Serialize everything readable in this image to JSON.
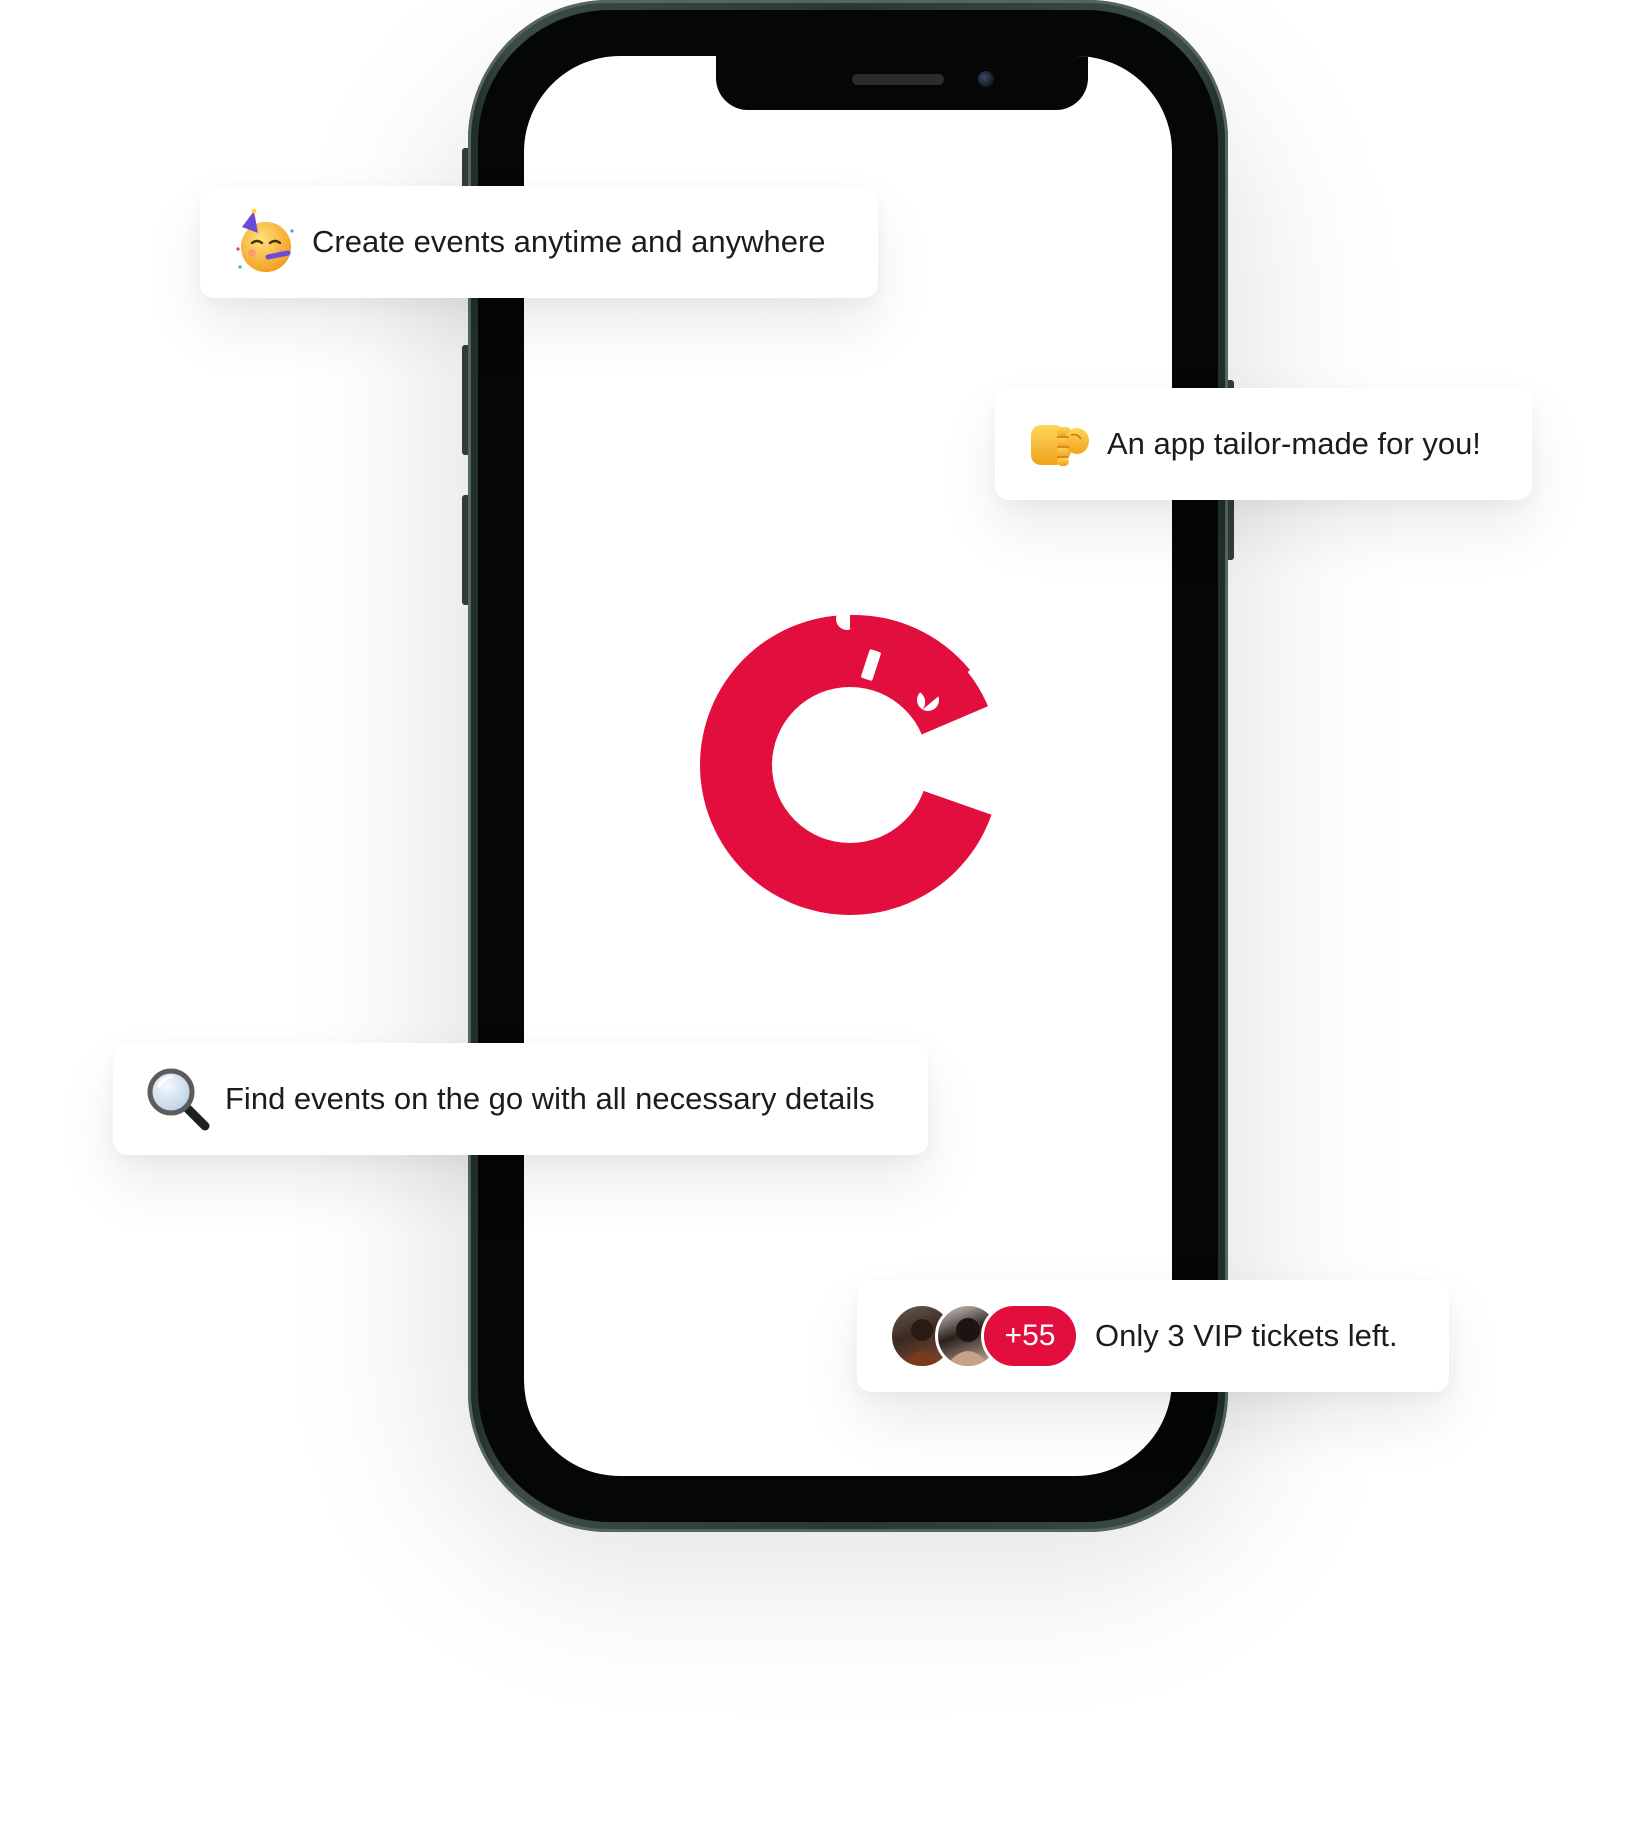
{
  "colors": {
    "brand": "#e20e3e",
    "phone_frame": "#2a3832",
    "screen": "#ffffff",
    "card_background": "#ffffff",
    "text": "#1c1c1e"
  },
  "phone": {
    "logo_icon": "brand-c-ticket-icon"
  },
  "cards": [
    {
      "icon": "partying-face-emoji",
      "text": "Create events anytime and anywhere"
    },
    {
      "icon": "pointing-hand-emoji",
      "text": "An app tailor-made for you!"
    },
    {
      "icon": "magnifying-glass-emoji",
      "text": "Find events on the go with all necessary details"
    },
    {
      "icon": "attendee-avatars",
      "badge": "+55",
      "text": "Only 3 VIP tickets left."
    }
  ]
}
